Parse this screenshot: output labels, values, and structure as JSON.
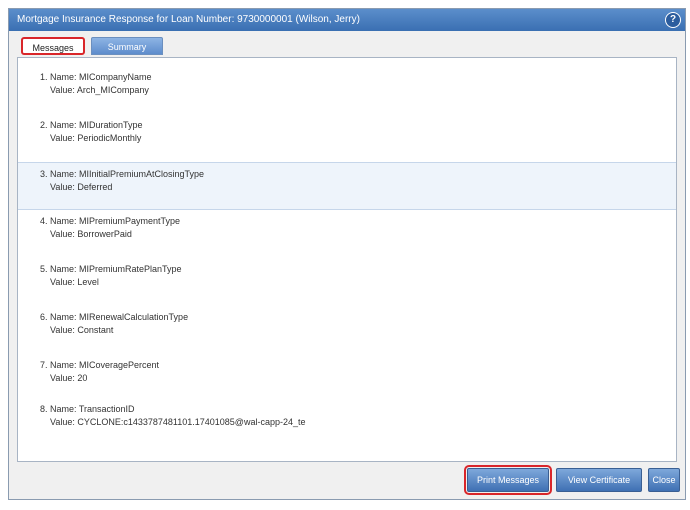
{
  "window": {
    "title": "Mortgage Insurance Response for Loan Number: 9730000001 (Wilson, Jerry)",
    "help_icon": "?"
  },
  "tabs": [
    {
      "label": "Messages",
      "active": true
    },
    {
      "label": "Summary",
      "active": false
    }
  ],
  "messages": [
    {
      "name": "1. Name: MICompanyName",
      "value": "Value: Arch_MICompany"
    },
    {
      "name": "2. Name: MIDurationType",
      "value": "Value: PeriodicMonthly"
    },
    {
      "name": "3. Name: MIInitialPremiumAtClosingType",
      "value": "Value: Deferred"
    },
    {
      "name": "4. Name: MIPremiumPaymentType",
      "value": "Value: BorrowerPaid"
    },
    {
      "name": "5. Name: MIPremiumRatePlanType",
      "value": "Value: Level"
    },
    {
      "name": "6. Name: MIRenewalCalculationType",
      "value": "Value: Constant"
    },
    {
      "name": "7. Name: MICoveragePercent",
      "value": "Value: 20"
    },
    {
      "name": "8. Name: TransactionID",
      "value": "Value: CYCLONE:c1433787481101.17401085@wal-capp-24_te"
    }
  ],
  "buttons": {
    "print": "Print Messages",
    "certificate": "View Certificate",
    "close": "Close"
  },
  "colors": {
    "title_bar": "#3a6fb2",
    "highlight": "#d9262a",
    "selected_row": "#eef4fb"
  }
}
